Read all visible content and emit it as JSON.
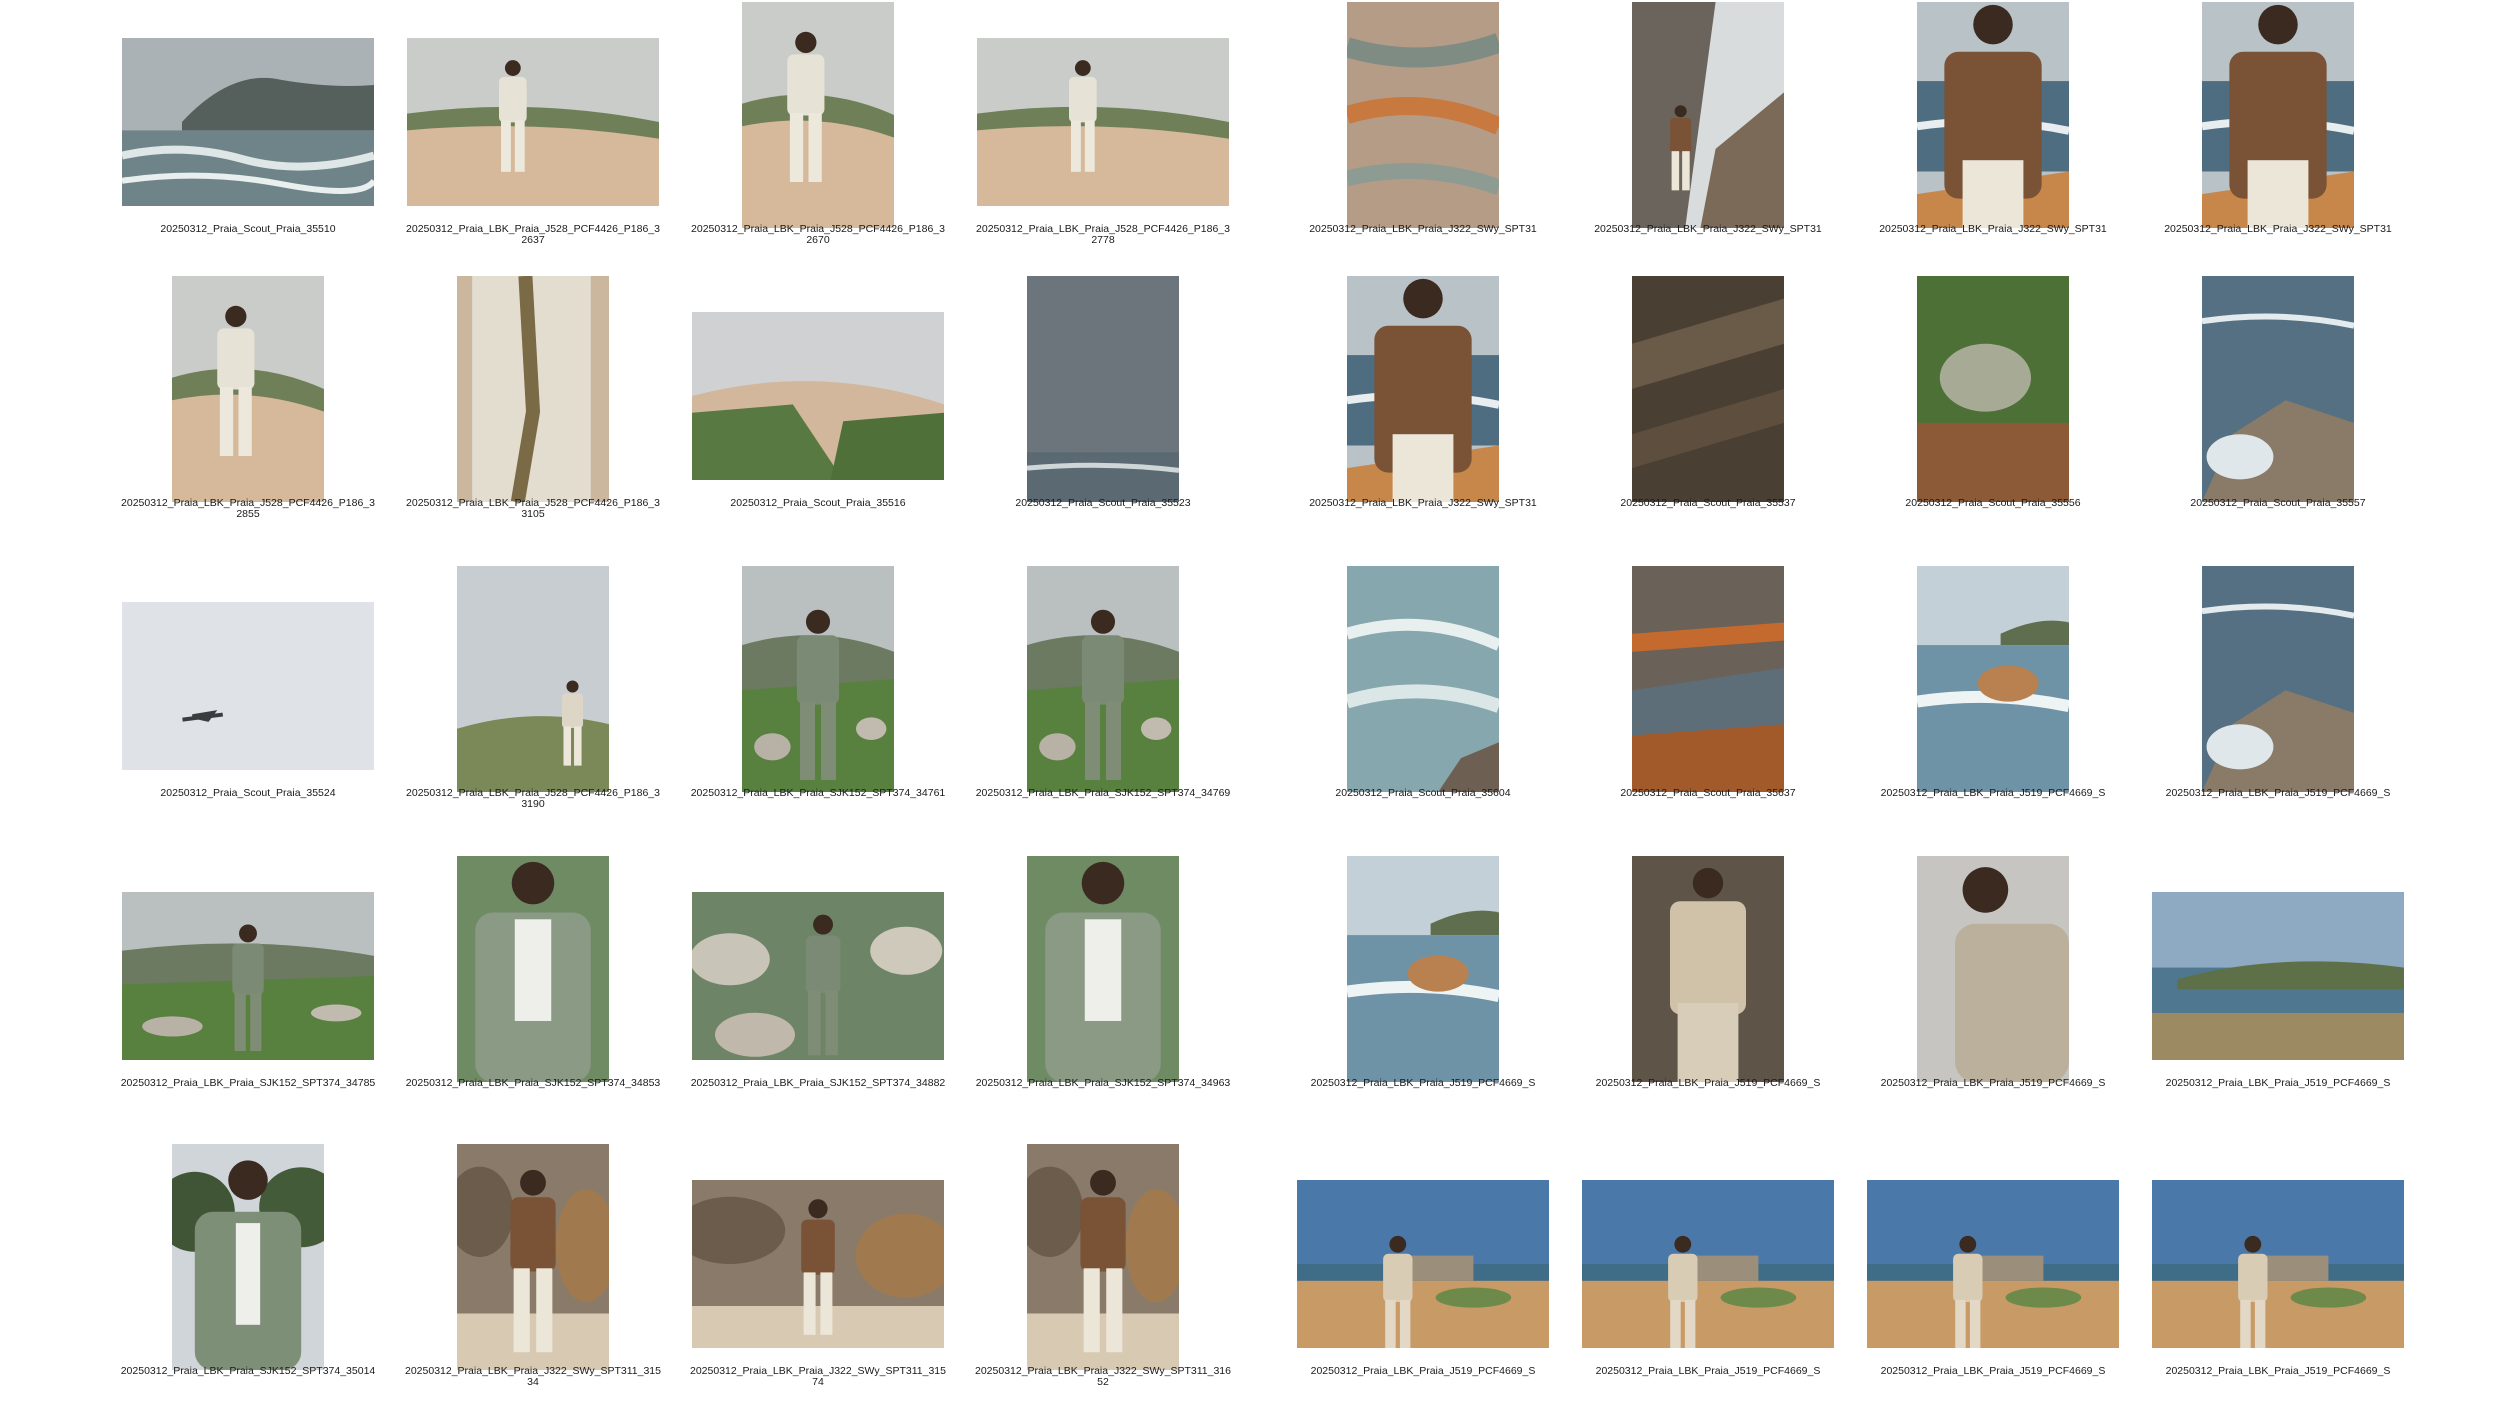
{
  "contact_sheet": {
    "left_panel": [
      {
        "caption": "20250312_Praia_Scout_Praia_35510",
        "orient": "land",
        "scene": "sea-cliff"
      },
      {
        "caption": "20250312_Praia_LBK_Praia_J528_PCF4426_P186_32637",
        "orient": "land",
        "scene": "dune-figure-light"
      },
      {
        "caption": "20250312_Praia_LBK_Praia_J528_PCF4426_P186_32670",
        "orient": "port",
        "scene": "dune-figure-light"
      },
      {
        "caption": "20250312_Praia_LBK_Praia_J528_PCF4426_P186_32778",
        "orient": "land",
        "scene": "dune-figure-light"
      },
      {
        "caption": "20250312_Praia_LBK_Praia_J528_PCF4426_P186_32855",
        "orient": "port",
        "scene": "dune-figure-light"
      },
      {
        "caption": "20250312_Praia_LBK_Praia_J528_PCF4426_P186_33105",
        "orient": "port",
        "scene": "jacket-closeup-light"
      },
      {
        "caption": "20250312_Praia_Scout_Praia_35516",
        "orient": "land",
        "scene": "dune-grass"
      },
      {
        "caption": "20250312_Praia_Scout_Praia_35523",
        "orient": "port",
        "scene": "grey-sea"
      },
      {
        "caption": "20250312_Praia_Scout_Praia_35524",
        "orient": "land",
        "scene": "sky-plane"
      },
      {
        "caption": "20250312_Praia_LBK_Praia_J528_PCF4426_P186_33190",
        "orient": "port",
        "scene": "hill-figure-light"
      },
      {
        "caption": "20250312_Praia_LBK_Praia_SJK152_SPT374_34761",
        "orient": "port",
        "scene": "green-suit-hill"
      },
      {
        "caption": "20250312_Praia_LBK_Praia_SJK152_SPT374_34769",
        "orient": "port",
        "scene": "green-suit-hill"
      },
      {
        "caption": "20250312_Praia_LBK_Praia_SJK152_SPT374_34785",
        "orient": "land",
        "scene": "green-suit-hill"
      },
      {
        "caption": "20250312_Praia_LBK_Praia_SJK152_SPT374_34853",
        "orient": "port",
        "scene": "green-suit-close"
      },
      {
        "caption": "20250312_Praia_LBK_Praia_SJK152_SPT374_34882",
        "orient": "land",
        "scene": "green-suit-rocks"
      },
      {
        "caption": "20250312_Praia_LBK_Praia_SJK152_SPT374_34963",
        "orient": "port",
        "scene": "green-suit-close"
      },
      {
        "caption": "20250312_Praia_LBK_Praia_SJK152_SPT374_35014",
        "orient": "port",
        "scene": "green-suit-trees"
      },
      {
        "caption": "20250312_Praia_LBK_Praia_J322_SWy_SPT311_31534",
        "orient": "port",
        "scene": "brown-jacket-rocks"
      },
      {
        "caption": "20250312_Praia_LBK_Praia_J322_SWy_SPT311_31574",
        "orient": "land",
        "scene": "brown-jacket-rocks"
      },
      {
        "caption": "20250312_Praia_LBK_Praia_J322_SWy_SPT311_31652",
        "orient": "port",
        "scene": "brown-jacket-rocks"
      }
    ],
    "right_panel": [
      {
        "caption": "20250312_Praia_LBK_Praia_J322_SWy_SPT31",
        "orient": "port",
        "scene": "rock-texture"
      },
      {
        "caption": "20250312_Praia_LBK_Praia_J322_SWy_SPT31",
        "orient": "port",
        "scene": "rock-cliff-figure"
      },
      {
        "caption": "20250312_Praia_LBK_Praia_J322_SWy_SPT31",
        "orient": "port",
        "scene": "brown-jacket-sea"
      },
      {
        "caption": "20250312_Praia_LBK_Praia_J322_SWy_SPT31",
        "orient": "port",
        "scene": "brown-jacket-sea"
      },
      {
        "caption": "20250312_Praia_LBK_Praia_J322_SWy_SPT31",
        "orient": "port",
        "scene": "brown-jacket-sea"
      },
      {
        "caption": "20250312_Praia_Scout_Praia_35537",
        "orient": "port",
        "scene": "dark-rock"
      },
      {
        "caption": "20250312_Praia_Scout_Praia_35556",
        "orient": "port",
        "scene": "green-shrub"
      },
      {
        "caption": "20250312_Praia_Scout_Praia_35557",
        "orient": "port",
        "scene": "wave-rock"
      },
      {
        "caption": "20250312_Praia_Scout_Praia_35604",
        "orient": "port",
        "scene": "foam-sea"
      },
      {
        "caption": "20250312_Praia_Scout_Praia_35637",
        "orient": "port",
        "scene": "orange-rocks-sea"
      },
      {
        "caption": "20250312_Praia_LBK_Praia_J519_PCF4669_S",
        "orient": "port",
        "scene": "coast-rocks"
      },
      {
        "caption": "20250312_Praia_LBK_Praia_J519_PCF4669_S",
        "orient": "port",
        "scene": "wave-rock"
      },
      {
        "caption": "20250312_Praia_LBK_Praia_J519_PCF4669_S",
        "orient": "port",
        "scene": "coast-rocks"
      },
      {
        "caption": "20250312_Praia_LBK_Praia_J519_PCF4669_S",
        "orient": "port",
        "scene": "beige-suit-ruin"
      },
      {
        "caption": "20250312_Praia_LBK_Praia_J519_PCF4669_S",
        "orient": "port",
        "scene": "beige-suit-close"
      },
      {
        "caption": "20250312_Praia_LBK_Praia_J519_PCF4669_S",
        "orient": "land",
        "scene": "coast-panorama"
      },
      {
        "caption": "20250312_Praia_LBK_Praia_J519_PCF4669_S",
        "orient": "land",
        "scene": "beige-suit-fort"
      },
      {
        "caption": "20250312_Praia_LBK_Praia_J519_PCF4669_S",
        "orient": "land",
        "scene": "beige-suit-fort"
      },
      {
        "caption": "20250312_Praia_LBK_Praia_J519_PCF4669_S",
        "orient": "land",
        "scene": "beige-suit-fort"
      },
      {
        "caption": "20250312_Praia_LBK_Praia_J519_PCF4669_S",
        "orient": "land",
        "scene": "beige-suit-fort"
      }
    ]
  }
}
